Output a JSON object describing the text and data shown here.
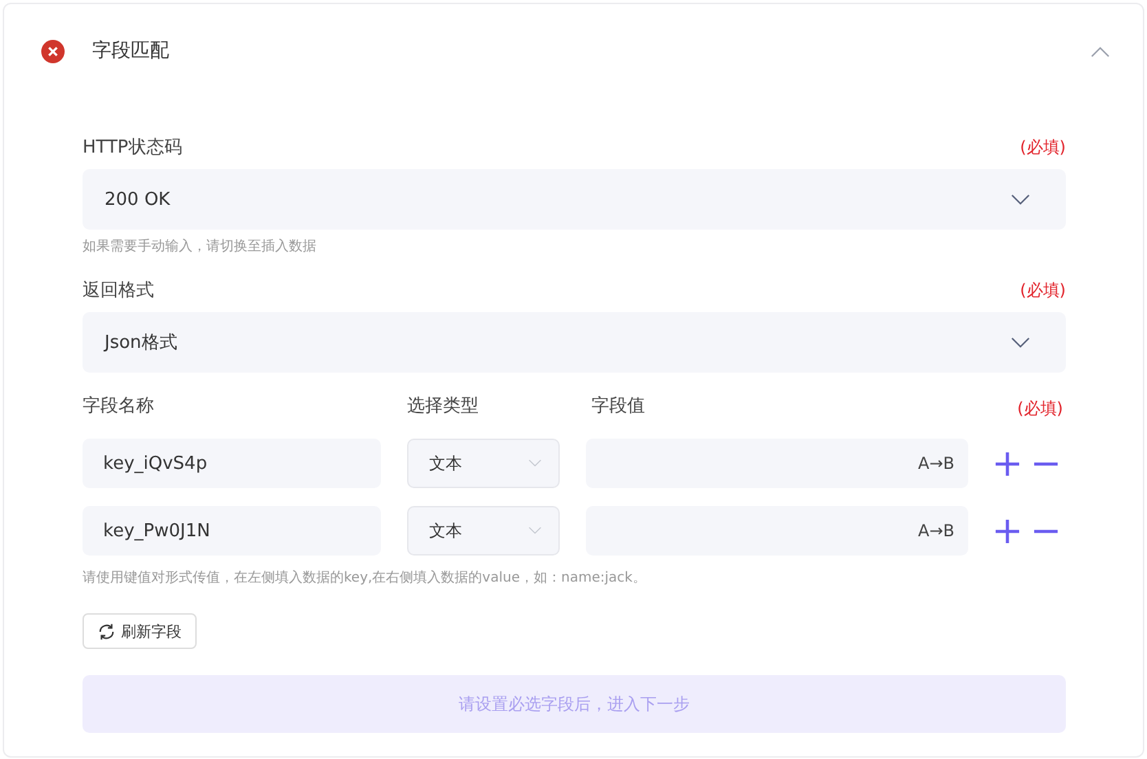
{
  "header": {
    "title": "字段匹配",
    "error": true,
    "expanded": true
  },
  "http_status": {
    "label": "HTTP状态码",
    "required": "(必填)",
    "value": "200 OK",
    "hint": "如果需要手动输入，请切换至插入数据"
  },
  "response_format": {
    "label": "返回格式",
    "required": "(必填)",
    "value": "Json格式"
  },
  "fields": {
    "columns": [
      "字段名称",
      "选择类型",
      "字段值"
    ],
    "required": "(必填)",
    "rows": [
      {
        "name": "key_iQvS4p",
        "type": "文本",
        "value_button": "A→B"
      },
      {
        "name": "key_Pw0J1N",
        "type": "文本",
        "value_button": "A→B"
      }
    ],
    "hint": "请使用键值对形式传值，在左侧填入数据的key,在右侧填入数据的value，如：name:jack。"
  },
  "refresh_button": "刷新字段",
  "next_button": {
    "label": "请设置必选字段后，进入下一步",
    "disabled": true
  }
}
